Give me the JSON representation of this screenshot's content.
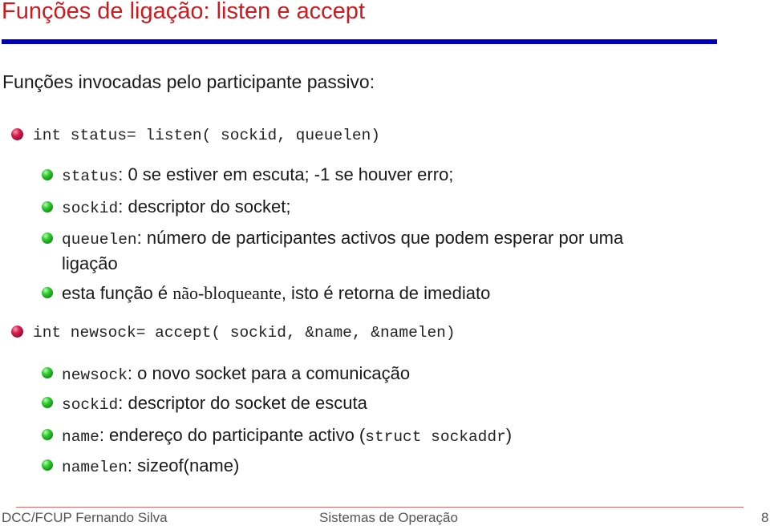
{
  "slide": {
    "title": "Funções de ligação: listen e accept",
    "intro": "Funções invocadas pelo participante passivo:",
    "items": [
      {
        "code": "int status= listen( sockid, queuelen)",
        "subitems": [
          {
            "code": "status",
            "sep": ": ",
            "text": "0 se estiver em escuta; -1 se houver erro;"
          },
          {
            "code": "sockid",
            "sep": ": ",
            "text": "descriptor do socket;"
          },
          {
            "code": "queuelen",
            "sep": ": ",
            "text": "número de participantes activos que podem esperar por uma",
            "text2": "ligação"
          },
          {
            "pre": "esta função é ",
            "emph": "não-bloqueante",
            "post": ", isto é retorna de imediato"
          }
        ]
      },
      {
        "code": "int newsock= accept( sockid, &name, &namelen)",
        "subitems": [
          {
            "code": "newsock",
            "sep": ": ",
            "text": "o novo socket para a comunicação"
          },
          {
            "code": "sockid",
            "sep": ": ",
            "text": "descriptor do socket de escuta"
          },
          {
            "code": "name",
            "sep": ": ",
            "text": "endereço do participante activo (",
            "code2": "struct sockaddr",
            "post": ")"
          },
          {
            "code": "namelen",
            "sep": ": ",
            "text": "sizeof(name)"
          }
        ]
      }
    ]
  },
  "footer": {
    "left": "DCC/FCUP Fernando Silva",
    "center": "Sistemas de Operação",
    "page": "8"
  },
  "colors": {
    "title": "#cc1a1f",
    "rule": "#0000bb",
    "footer_rule": "#d76a6a"
  }
}
